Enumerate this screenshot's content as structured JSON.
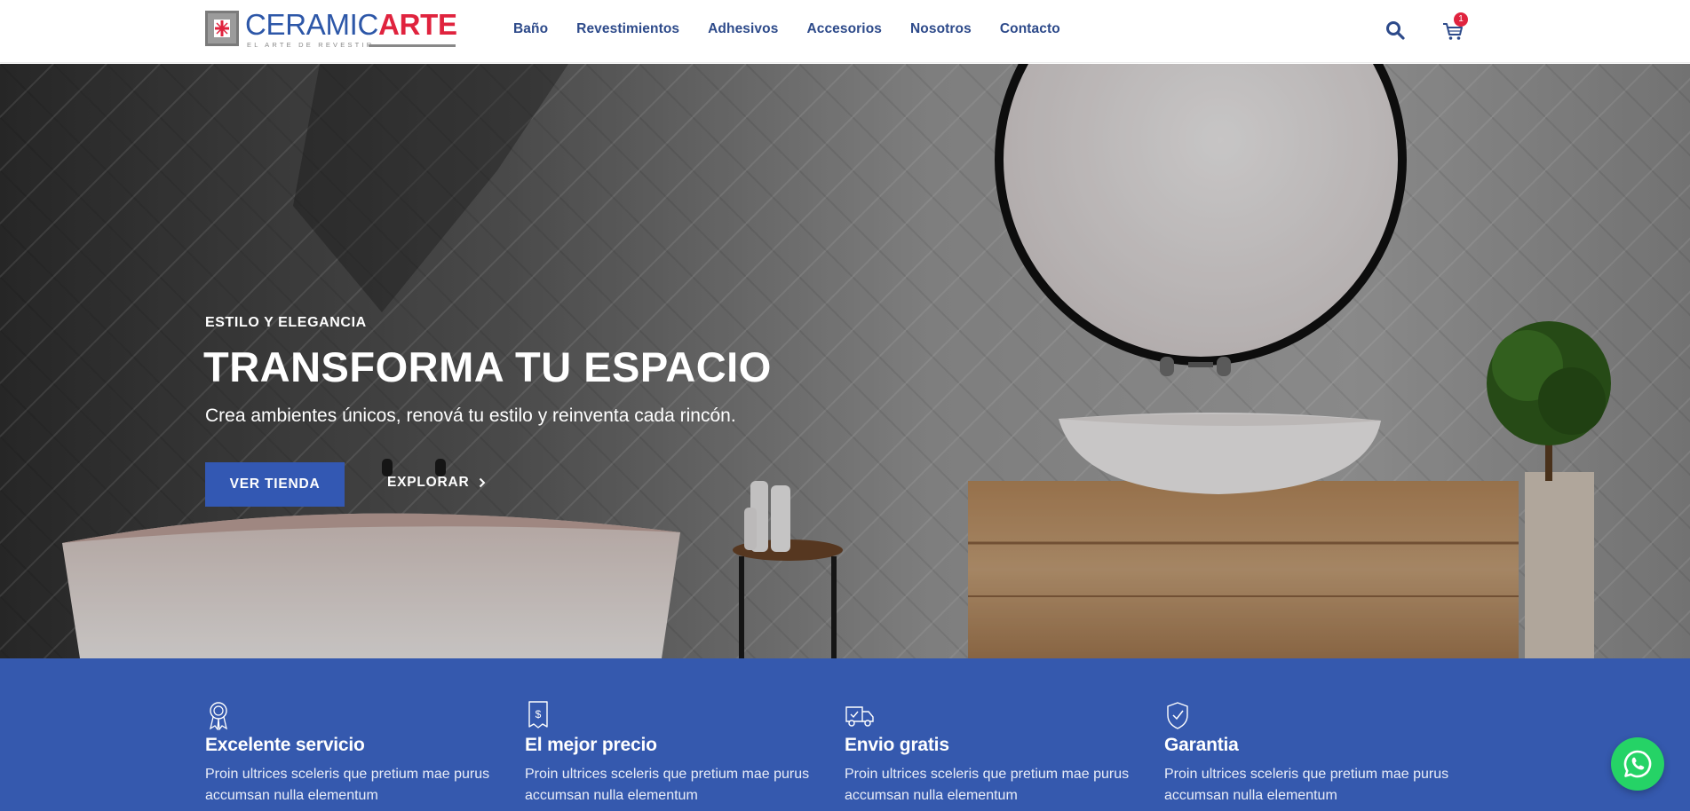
{
  "brand": {
    "name_part1": "CERAMIC",
    "name_part2": "ARTE",
    "tagline": "EL ARTE DE REVESTIR",
    "primary_color": "#2d57a8",
    "accent_color": "#e0233e"
  },
  "nav": {
    "items": [
      {
        "label": "Baño"
      },
      {
        "label": "Revestimientos"
      },
      {
        "label": "Adhesivos"
      },
      {
        "label": "Accesorios"
      },
      {
        "label": "Nosotros"
      },
      {
        "label": "Contacto"
      }
    ]
  },
  "header_actions": {
    "search_icon": "search-icon",
    "cart_icon": "cart-icon",
    "cart_count": "1"
  },
  "hero": {
    "kicker": "ESTILO Y ELEGANCIA",
    "title": "TRANSFORMA TU ESPACIO",
    "subtitle": "Crea ambientes únicos, renová tu estilo y reinventa cada rincón.",
    "primary_button": "VER TIENDA",
    "secondary_link": "EXPLORAR",
    "button_color": "#3358b3"
  },
  "features": {
    "background": "#3559ae",
    "items": [
      {
        "icon": "award-ribbon-icon",
        "title": "Excelente servicio",
        "text": "Proin ultrices sceleris que pretium mae purus accumsan nulla elementum"
      },
      {
        "icon": "price-tag-icon",
        "title": "El mejor precio",
        "text": "Proin ultrices sceleris que pretium mae purus accumsan nulla elementum"
      },
      {
        "icon": "delivery-truck-icon",
        "title": "Envio gratis",
        "text": "Proin ultrices sceleris que pretium mae purus accumsan nulla elementum"
      },
      {
        "icon": "shield-check-icon",
        "title": "Garantia",
        "text": "Proin ultrices sceleris que pretium mae purus accumsan nulla elementum"
      }
    ]
  },
  "floating": {
    "whatsapp_icon": "whatsapp-icon",
    "whatsapp_color": "#25d366"
  }
}
